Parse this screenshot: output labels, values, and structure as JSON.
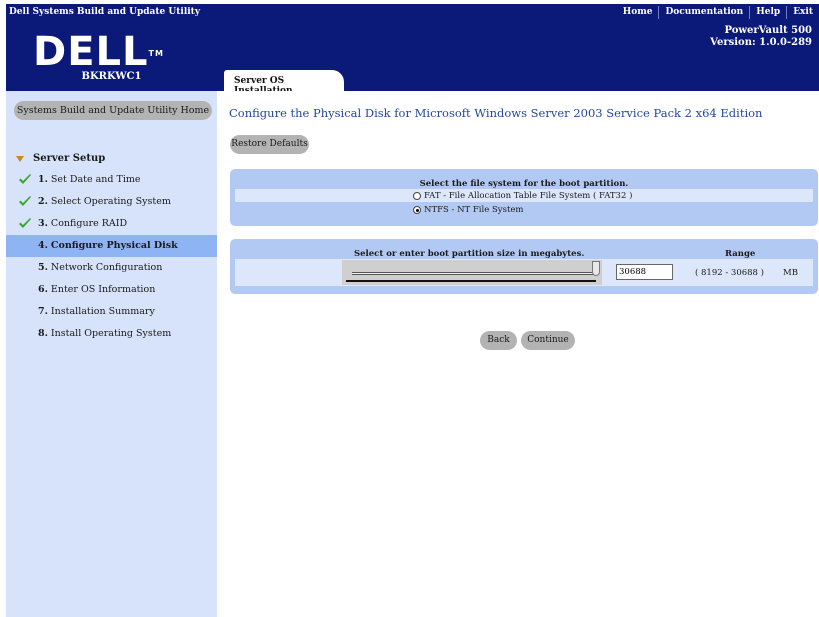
{
  "topbar": {
    "app_title": "Dell Systems Build and Update Utility",
    "links": [
      "Home",
      "Documentation",
      "Help",
      "Exit"
    ]
  },
  "banner": {
    "logo_text": "DELL",
    "logo_tm": "TM",
    "product": "PowerVault 500",
    "version": "Version: 1.0.0-289",
    "hostname": "BKRKWC1"
  },
  "tab": {
    "label": "Server OS Installation"
  },
  "sidebar": {
    "home_button": "Systems Build and Update Utility Home",
    "section": "Server Setup",
    "steps": [
      {
        "num": "1.",
        "label": "Set Date and Time",
        "done": true
      },
      {
        "num": "2.",
        "label": "Select Operating System",
        "done": true
      },
      {
        "num": "3.",
        "label": "Configure RAID",
        "done": true
      },
      {
        "num": "4.",
        "label": "Configure Physical Disk",
        "active": true
      },
      {
        "num": "5.",
        "label": "Network Configuration"
      },
      {
        "num": "6.",
        "label": "Enter OS Information"
      },
      {
        "num": "7.",
        "label": "Installation Summary"
      },
      {
        "num": "8.",
        "label": "Install Operating System"
      }
    ]
  },
  "main": {
    "title": "Configure the Physical Disk for Microsoft Windows Server 2003 Service Pack 2 x64 Edition",
    "restore_button": "Restore Defaults",
    "fs_heading": "Select the file system for the boot partition.",
    "fs_options": [
      {
        "label": "FAT - File Allocation Table File System ( FAT32 )",
        "selected": false
      },
      {
        "label": "NTFS - NT File System",
        "selected": true
      }
    ],
    "size_label": "Select or enter boot partition size in megabytes.",
    "range_label": "Range",
    "size_value": "30688",
    "range_value": "( 8192 - 30688 )",
    "unit": "MB",
    "back_button": "Back",
    "continue_button": "Continue"
  },
  "colors": {
    "header_bg": "#0b1a78",
    "sidebar_bg": "#d7e3fa",
    "active_step": "#8fb4f3",
    "panel_bg": "#b2c9f3",
    "title_color": "#23479e",
    "check_color": "#3aa52a"
  }
}
